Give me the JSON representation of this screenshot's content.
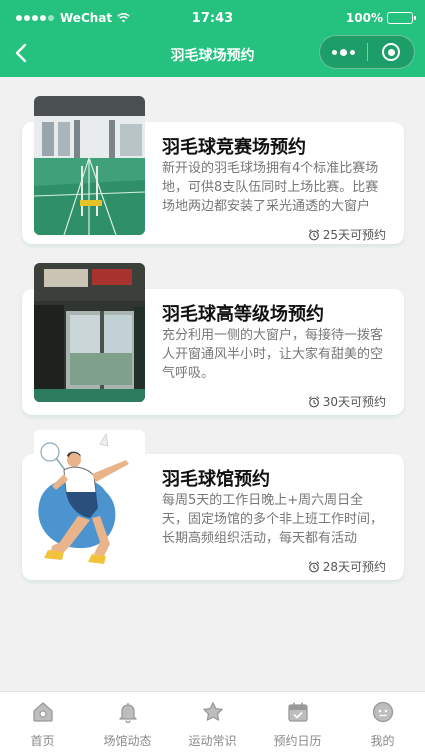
{
  "status_bar": {
    "carrier": "WeChat",
    "time": "17:43",
    "battery": "100%"
  },
  "nav": {
    "title": "羽毛球场预约"
  },
  "cards": [
    {
      "title": "羽毛球竞赛场预约",
      "description": "新开设的羽毛球场拥有4个标准比赛场地，可供8支队伍同时上场比赛。比赛场地两边都安装了采光通透的大窗户",
      "footer": "25天可预约",
      "image": "gym-court-photo"
    },
    {
      "title": "羽毛球高等级场预约",
      "description": "充分利用一侧的大窗户，每接待一拨客人开窗通风半小时，让大家有甜美的空气呼吸。",
      "footer": "30天可预约",
      "image": "court-window-photo"
    },
    {
      "title": "羽毛球馆预约",
      "description": "每周5天的工作日晚上+周六周日全天，固定场馆的多个非上班工作时间，长期高频组织活动，每天都有活动",
      "footer": "28天可预约",
      "image": "badminton-player-illustration"
    }
  ],
  "tabbar": {
    "items": [
      {
        "label": "首页",
        "icon": "home-icon"
      },
      {
        "label": "场馆动态",
        "icon": "bell-icon"
      },
      {
        "label": "运动常识",
        "icon": "star-icon"
      },
      {
        "label": "预约日历",
        "icon": "calendar-icon"
      },
      {
        "label": "我的",
        "icon": "profile-icon"
      }
    ]
  },
  "colors": {
    "brand": "#24c17f",
    "tab_icon": "#999999"
  }
}
